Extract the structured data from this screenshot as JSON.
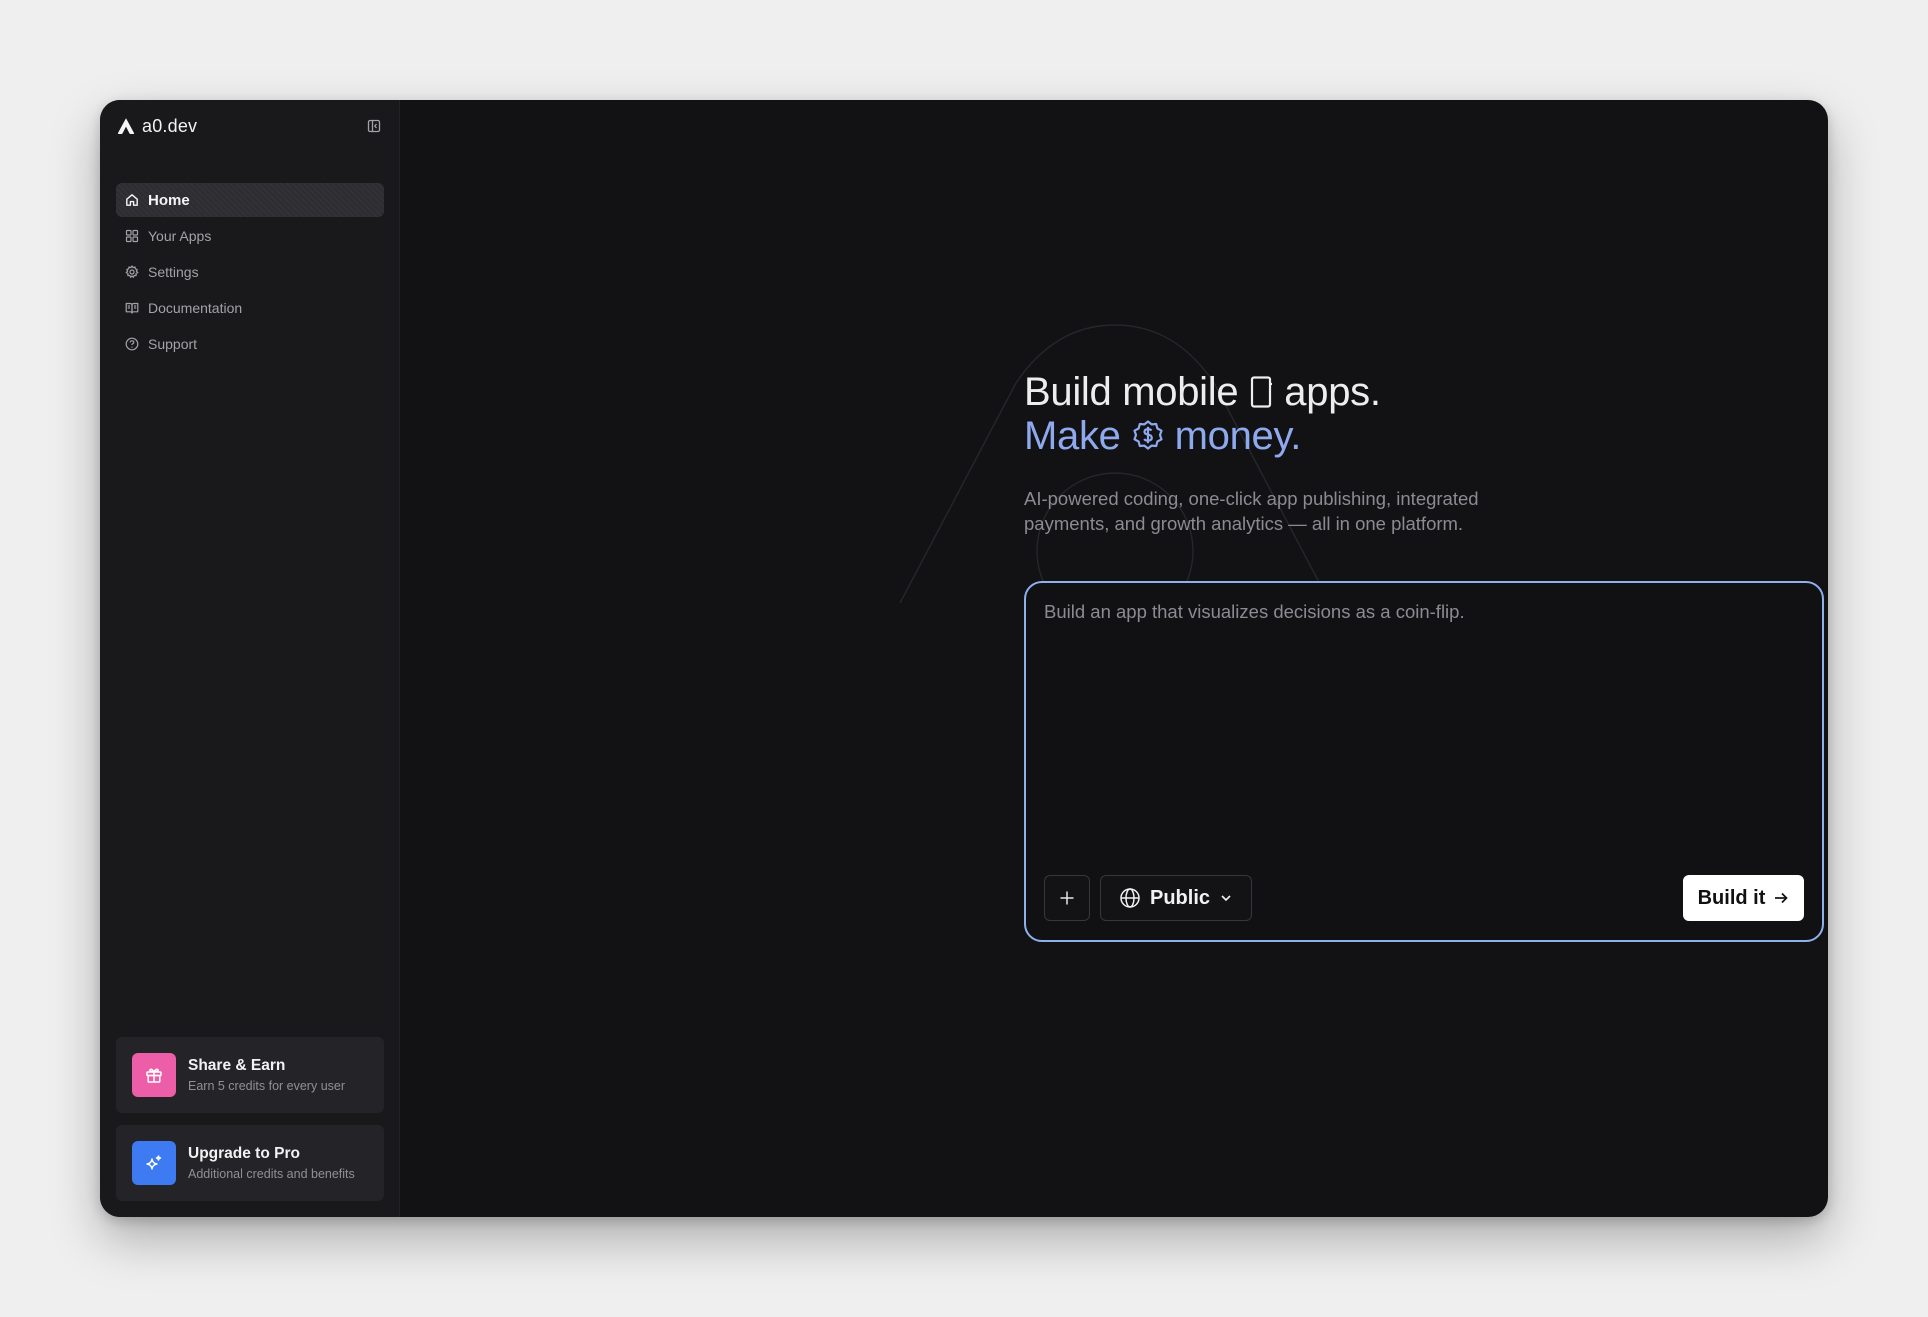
{
  "brand": {
    "name": "a0.dev",
    "logo": "a0-logo"
  },
  "sidebar": {
    "collapse_icon": "sidebar-collapse-icon",
    "items": [
      {
        "label": "Home",
        "icon": "home-icon",
        "active": true
      },
      {
        "label": "Your Apps",
        "icon": "grid-icon",
        "active": false
      },
      {
        "label": "Settings",
        "icon": "gear-icon",
        "active": false
      },
      {
        "label": "Documentation",
        "icon": "book-icon",
        "active": false
      },
      {
        "label": "Support",
        "icon": "help-circle-icon",
        "active": false
      }
    ],
    "promos": [
      {
        "title": "Share & Earn",
        "subtitle": "Earn 5 credits for every user",
        "icon": "gift-icon",
        "color": "#ec5fa8"
      },
      {
        "title": "Upgrade to Pro",
        "subtitle": "Additional credits and benefits",
        "icon": "sparkles-icon",
        "color": "#3e7bf2"
      }
    ]
  },
  "hero": {
    "line1_a": "Build mobile",
    "line1_b": "apps.",
    "line2_a": "Make",
    "line2_b": "money.",
    "subtitle": "AI-powered coding, one-click app publishing, integrated payments, and growth analytics — all in one platform.",
    "accent_color": "#8fa9ee"
  },
  "composer": {
    "placeholder": "Build an app that visualizes decisions as a coin-flip.",
    "value": "",
    "visibility": "Public",
    "submit_label": "Build it",
    "border_color": "#8db0ef"
  }
}
